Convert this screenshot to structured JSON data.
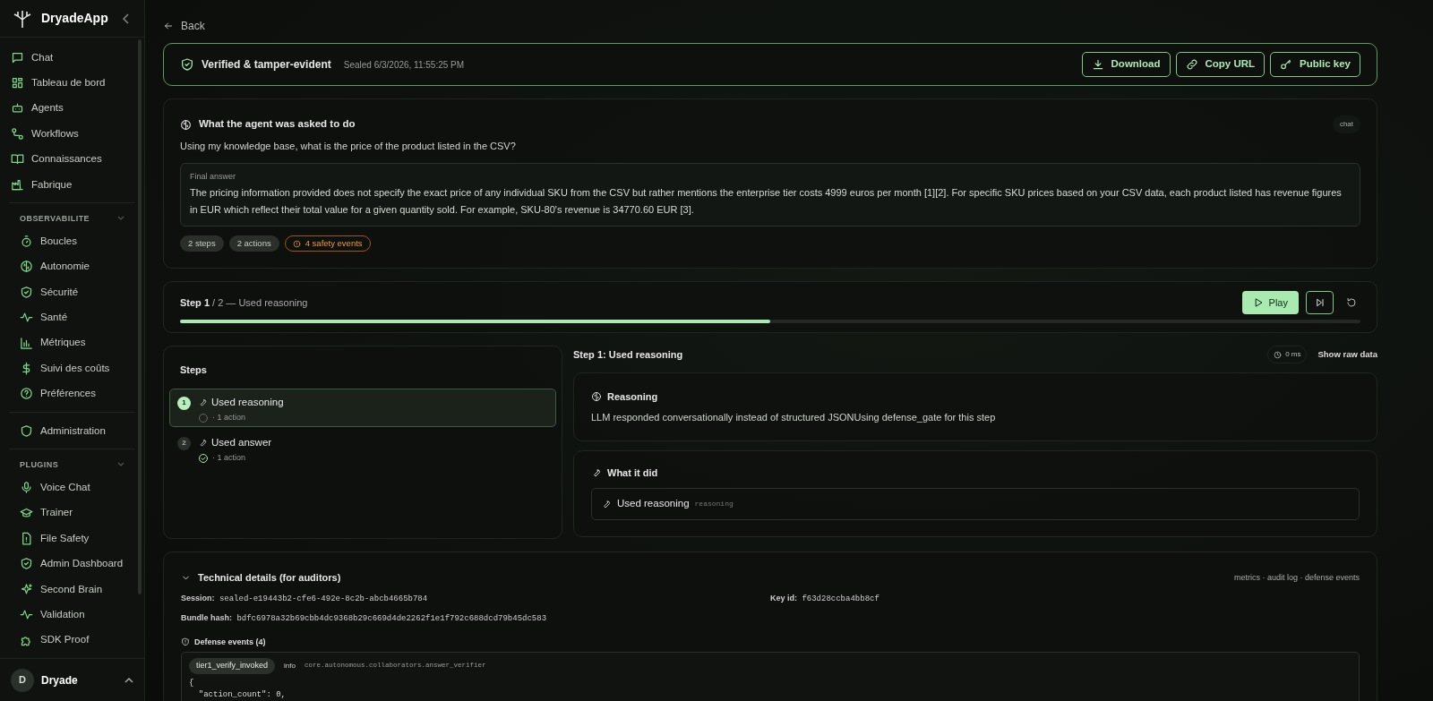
{
  "sidebar": {
    "brand": "DryadeApp",
    "groups": [
      {
        "items": [
          {
            "label": "Chat"
          },
          {
            "label": "Tableau de bord"
          },
          {
            "label": "Agents"
          },
          {
            "label": "Workflows"
          },
          {
            "label": "Connaissances"
          },
          {
            "label": "Fabrique"
          }
        ]
      },
      {
        "heading": "OBSERVABILITE",
        "items": [
          {
            "label": "Boucles"
          },
          {
            "label": "Autonomie"
          },
          {
            "label": "Sécurité"
          },
          {
            "label": "Santé"
          },
          {
            "label": "Métriques"
          },
          {
            "label": "Suivi des coûts"
          },
          {
            "label": "Préférences"
          }
        ]
      },
      {
        "items": [
          {
            "label": "Administration"
          }
        ]
      },
      {
        "heading": "PLUGINS",
        "items": [
          {
            "label": "Voice Chat"
          },
          {
            "label": "Trainer"
          },
          {
            "label": "File Safety"
          },
          {
            "label": "Admin Dashboard"
          },
          {
            "label": "Second Brain"
          },
          {
            "label": "Validation"
          },
          {
            "label": "SDK Proof"
          }
        ]
      }
    ],
    "user": {
      "initial": "D",
      "name": "Dryade"
    }
  },
  "back": "Back",
  "seal": {
    "title": "Verified & tamper-evident",
    "sealed": "Sealed 6/3/2026, 11:55:25 PM",
    "buttons": [
      "Download",
      "Copy URL",
      "Public key"
    ]
  },
  "prompt": {
    "heading": "What the agent was asked to do",
    "tag": "chat",
    "question": "Using my knowledge base, what is the price of the product listed in the CSV?",
    "answer_label": "Final answer",
    "answer": "The pricing information provided does not specify the exact price of any individual SKU from the CSV but rather mentions the enterprise tier costs 4999 euros per month [1][2]. For specific SKU prices based on your CSV data, each product listed has revenue figures in EUR which reflect their total value for a given quantity sold. For example, SKU-80's revenue is 34770.60 EUR [3].",
    "badges": [
      {
        "kind": "plain",
        "text": "2 steps"
      },
      {
        "kind": "plain",
        "text": "2 actions"
      },
      {
        "kind": "warning",
        "text": "4 safety events"
      }
    ]
  },
  "player": {
    "step": "Step 1",
    "total": "/ 2 — Used reasoning",
    "play": "Play",
    "level": 0.5
  },
  "steps": {
    "heading": "Steps",
    "items": [
      {
        "number": "1",
        "title": "Used reasoning",
        "meta": "· 1 action",
        "selected": true,
        "done": false
      },
      {
        "number": "2",
        "title": "Used answer",
        "meta": "· 1 action",
        "selected": false,
        "done": true
      }
    ]
  },
  "detail": {
    "title": "Step 1: Used reasoning",
    "duration": "0 ms",
    "raw": "Show raw data",
    "reasoning_heading": "Reasoning",
    "reasoning": "LLM responded conversationally instead of structured JSONUsing defense_gate for this step",
    "did_heading": "What it did",
    "action": "Used reasoning",
    "action_kind": "reasoning"
  },
  "technical": {
    "heading": "Technical details (for auditors)",
    "links": "metrics · audit log · defense events",
    "session_label": "Session:",
    "session": "sealed-e19443b2-cfe6-492e-8c2b-abcb4665b784",
    "key_label": "Key id:",
    "key": "f63d28ccba4bb8cf",
    "hash_label": "Bundle hash:",
    "hash": "bdfc6978a32b69cbb4dc9368b29c669d4de2262f1e1f792c688dcd79b45dc583",
    "events_heading": "Defense events (4)",
    "event": {
      "name": "tier1_verify_invoked",
      "level": "info",
      "source": "core.autonomous.collaborators.answer_verifier",
      "body": "{\n  \"action_count\": 0,"
    }
  }
}
